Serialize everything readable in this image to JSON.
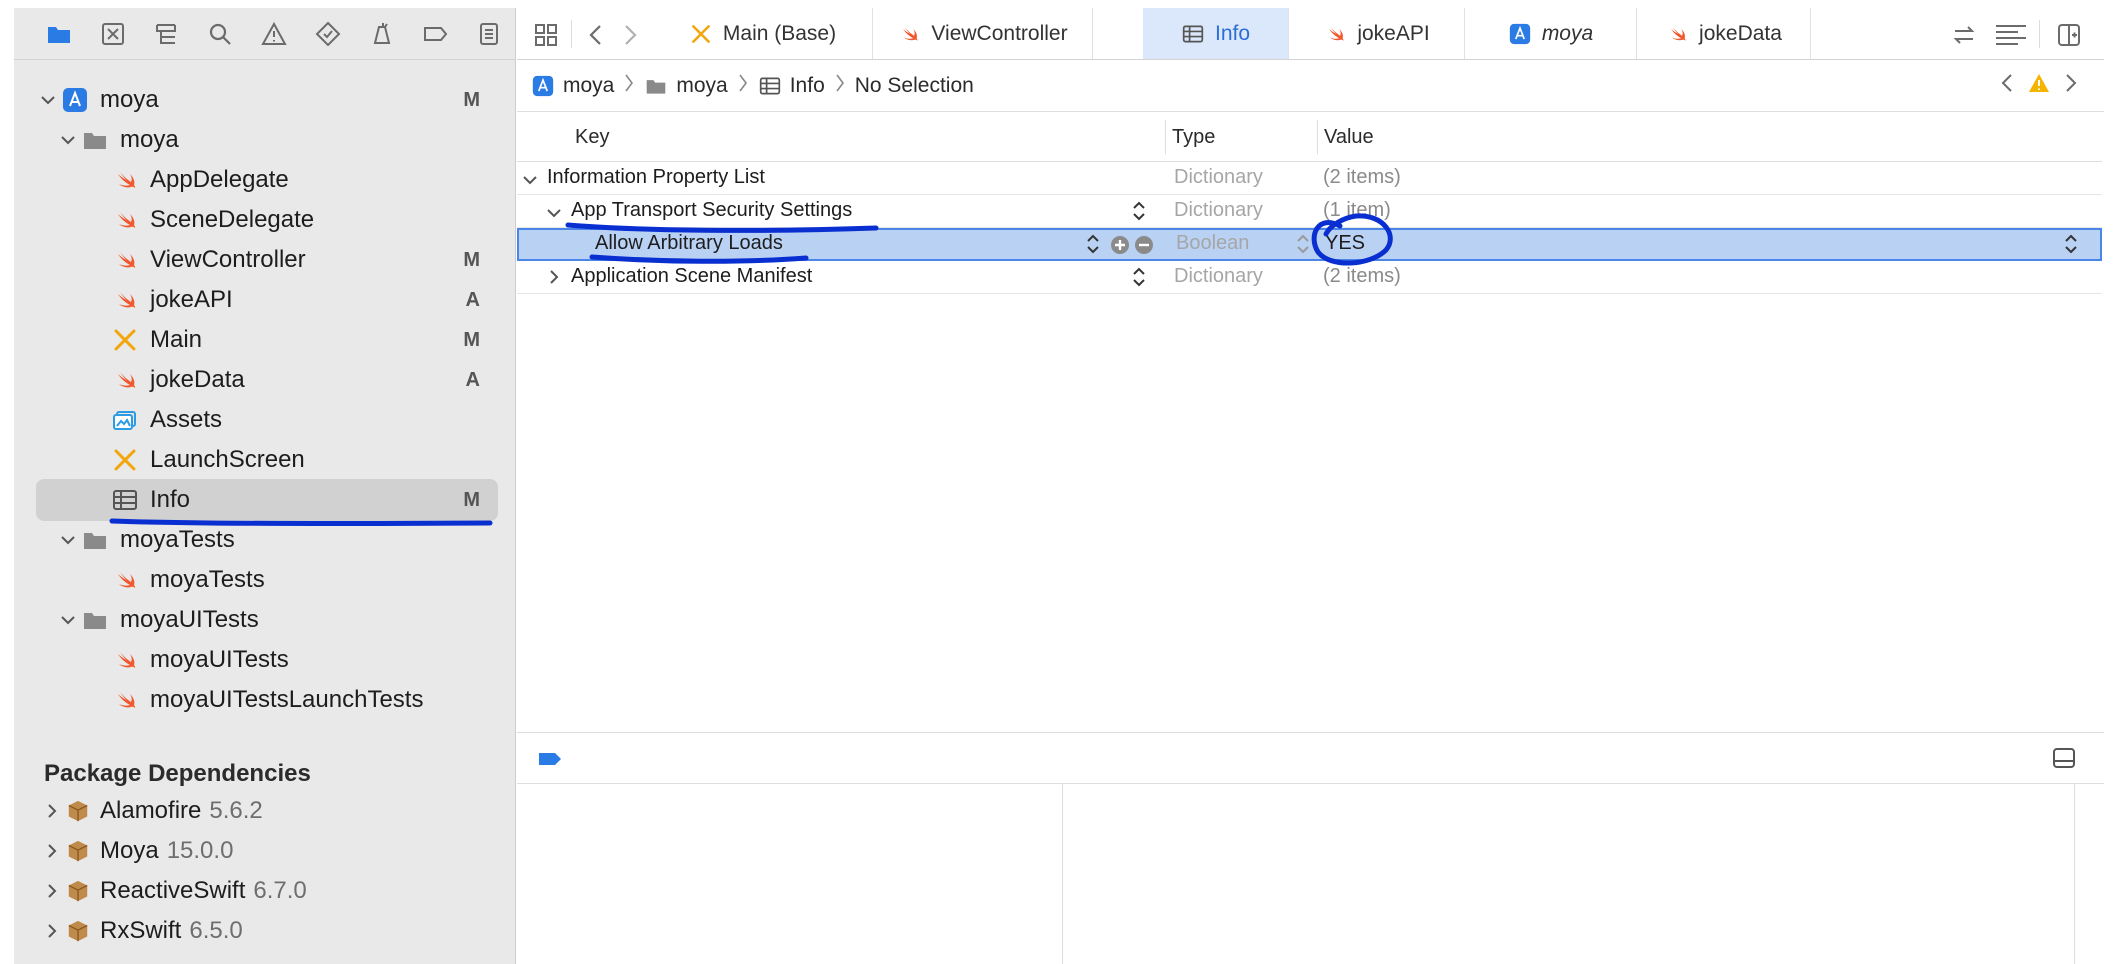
{
  "sidebar": {
    "toolbar_icons": [
      "folder-icon",
      "source-control-icon",
      "symbol-icon",
      "search-icon",
      "warning-icon",
      "test-icon",
      "debug-icon",
      "breakpoint-icon",
      "report-icon"
    ],
    "tree": [
      {
        "label": "moya",
        "status": "M",
        "icon": "app-icon",
        "level": 0,
        "expanded": true
      },
      {
        "label": "moya",
        "status": "",
        "icon": "folder-icon",
        "level": 1,
        "expanded": true
      },
      {
        "label": "AppDelegate",
        "status": "",
        "icon": "swift-icon",
        "level": 2
      },
      {
        "label": "SceneDelegate",
        "status": "",
        "icon": "swift-icon",
        "level": 2
      },
      {
        "label": "ViewController",
        "status": "M",
        "icon": "swift-icon",
        "level": 2
      },
      {
        "label": "jokeAPI",
        "status": "A",
        "icon": "swift-icon",
        "level": 2
      },
      {
        "label": "Main",
        "status": "M",
        "icon": "storyboard-icon",
        "level": 2
      },
      {
        "label": "jokeData",
        "status": "A",
        "icon": "swift-icon",
        "level": 2
      },
      {
        "label": "Assets",
        "status": "",
        "icon": "assets-icon",
        "level": 2
      },
      {
        "label": "LaunchScreen",
        "status": "",
        "icon": "storyboard-icon",
        "level": 2
      },
      {
        "label": "Info",
        "status": "M",
        "icon": "plist-icon",
        "level": 2,
        "selected": true
      },
      {
        "label": "moyaTests",
        "status": "",
        "icon": "folder-icon",
        "level": 1,
        "expanded": true
      },
      {
        "label": "moyaTests",
        "status": "",
        "icon": "swift-icon",
        "level": 2
      },
      {
        "label": "moyaUITests",
        "status": "",
        "icon": "folder-icon",
        "level": 1,
        "expanded": true
      },
      {
        "label": "moyaUITests",
        "status": "",
        "icon": "swift-icon",
        "level": 2
      },
      {
        "label": "moyaUITestsLaunchTests",
        "status": "",
        "icon": "swift-icon",
        "level": 2
      }
    ],
    "packages_title": "Package Dependencies",
    "packages": [
      {
        "name": "Alamofire",
        "version": "5.6.2"
      },
      {
        "name": "Moya",
        "version": "15.0.0"
      },
      {
        "name": "ReactiveSwift",
        "version": "6.7.0"
      },
      {
        "name": "RxSwift",
        "version": "6.5.0"
      }
    ]
  },
  "tabs": [
    {
      "label": "Main (Base)",
      "icon": "storyboard-icon",
      "active": false,
      "italic": false
    },
    {
      "label": "ViewController",
      "icon": "swift-icon",
      "active": false,
      "italic": false
    },
    {
      "label": "Info",
      "icon": "plist-icon",
      "active": true,
      "italic": false
    },
    {
      "label": "jokeAPI",
      "icon": "swift-icon",
      "active": false,
      "italic": false
    },
    {
      "label": "moya",
      "icon": "app-icon",
      "active": false,
      "italic": true
    },
    {
      "label": "jokeData",
      "icon": "swift-icon",
      "active": false,
      "italic": false
    }
  ],
  "breadcrumb": [
    {
      "label": "moya",
      "icon": "app-icon"
    },
    {
      "label": "moya",
      "icon": "folder-icon"
    },
    {
      "label": "Info",
      "icon": "plist-icon"
    },
    {
      "label": "No Selection",
      "icon": ""
    }
  ],
  "plist": {
    "headers": {
      "key": "Key",
      "type": "Type",
      "value": "Value"
    },
    "rows": [
      {
        "key": "Information Property List",
        "type": "Dictionary",
        "value": "(2 items)"
      },
      {
        "key": "App Transport Security Settings",
        "type": "Dictionary",
        "value": "(1 item)"
      },
      {
        "key": "Allow Arbitrary Loads",
        "type": "Boolean",
        "value": "YES"
      },
      {
        "key": "Application Scene Manifest",
        "type": "Dictionary",
        "value": "(2 items)"
      }
    ]
  },
  "colors": {
    "accent": "#2b6fd6",
    "annotation_pen": "#0a2fd1",
    "swift_orange": "#f0582e",
    "warning": "#f5b400"
  }
}
